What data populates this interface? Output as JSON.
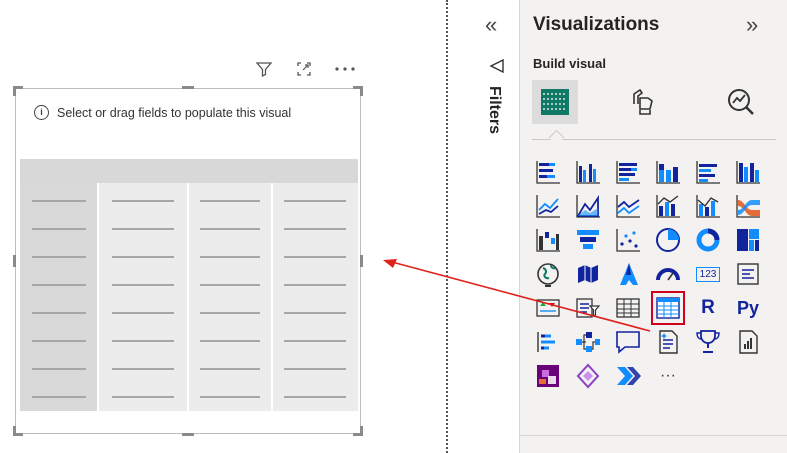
{
  "canvas": {
    "hint": "Select or drag fields to populate this visual",
    "table_columns": 4,
    "table_rows": 8
  },
  "filters": {
    "label": "Filters"
  },
  "visualizations": {
    "title": "Visualizations",
    "build_label": "Build visual",
    "tabs": [
      "build-visual-tab",
      "format-visual-tab",
      "analytics-tab"
    ],
    "more_label": "···",
    "icons": [
      [
        "stacked-bar-chart-icon",
        "clustered-bar-chart-icon",
        "100-stacked-bar-chart-icon",
        "stacked-column-chart-icon",
        "clustered-column-chart-icon",
        "100-stacked-column-chart-icon"
      ],
      [
        "line-chart-icon",
        "area-chart-icon",
        "stacked-area-chart-icon",
        "line-stacked-column-chart-icon",
        "line-clustered-column-chart-icon",
        "ribbon-chart-icon"
      ],
      [
        "waterfall-chart-icon",
        "funnel-chart-icon",
        "scatter-chart-icon",
        "pie-chart-icon",
        "donut-chart-icon",
        "treemap-icon"
      ],
      [
        "map-icon",
        "filled-map-icon",
        "azure-map-icon",
        "gauge-icon",
        "card-icon",
        "multi-row-card-icon"
      ],
      [
        "kpi-icon",
        "slicer-icon",
        "table-icon",
        "matrix-icon",
        "r-visual-icon",
        "python-visual-icon"
      ],
      [
        "key-influencers-icon",
        "decomposition-tree-icon",
        "qa-icon",
        "smart-narrative-icon",
        "metrics-icon",
        "paginated-report-icon"
      ],
      [
        "power-apps-icon",
        "power-automate-icon",
        "more-visuals-icon"
      ]
    ],
    "r_text": "R",
    "py_text": "Py",
    "card_text": "123"
  },
  "colors": {
    "accent": "#117865",
    "blue": "#118dff",
    "navy": "#12239e",
    "orange": "#e66c37",
    "purple": "#6b007b",
    "red": "#d0021b"
  }
}
